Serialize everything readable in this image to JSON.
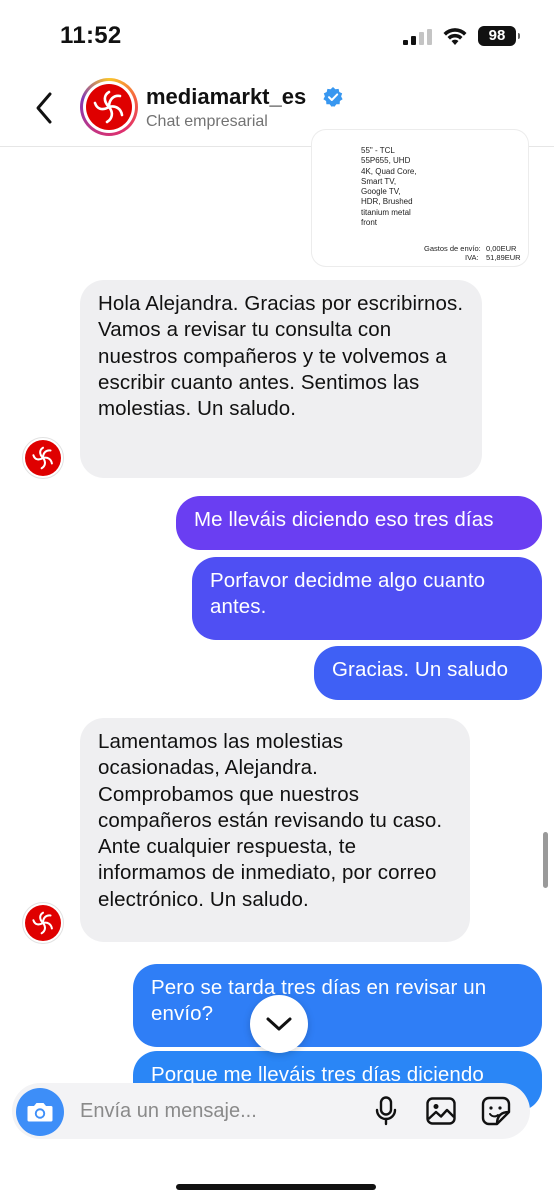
{
  "status_bar": {
    "time": "11:52",
    "battery": "98"
  },
  "header": {
    "name": "mediamarkt_es",
    "subtitle": "Chat empresarial"
  },
  "invoice": {
    "product": "55\" - TCL 55P655, UHD 4K, Quad Core, Smart TV, Google TV, HDR, Brushed titanium metal front",
    "shipping_label": "Gastos de envío:",
    "shipping_value": "0,00EUR",
    "vat_label": "IVA:",
    "vat_value": "51,89EUR"
  },
  "messages": [
    {
      "type": "received",
      "text": "Hola Alejandra. Gracias por escribirnos. Vamos a revisar tu consulta con nuestros compañeros y te volvemos a escribir cuanto antes. Sentimos las molestias. Un saludo."
    },
    {
      "type": "sent",
      "text": "Me lleváis diciendo eso tres días"
    },
    {
      "type": "sent",
      "text": "Porfavor decidme algo cuanto antes."
    },
    {
      "type": "sent",
      "text": "Gracias. Un saludo"
    },
    {
      "type": "received",
      "text": "Lamentamos las molestias ocasionadas, Alejandra. Comprobamos que nuestros compañeros están revisando tu caso. Ante cualquier respuesta, te informamos de inmediato, por correo electrónico. Un saludo."
    },
    {
      "type": "sent",
      "text": "Pero se tarda tres días en revisar un envío?"
    },
    {
      "type": "sent",
      "text": "Porque me lleváis tres días diciendo"
    }
  ],
  "composer": {
    "placeholder": "Envía un mensaje..."
  },
  "colors": {
    "sent_1": "#6a3ef2",
    "sent_2": "#4f4ff3",
    "sent_3": "#3f60f5",
    "sent_4": "#2f7ef6",
    "sent_5": "#2a86f6",
    "received": "#efeff1",
    "brand_red": "#df0000",
    "camera": "#3d8ef8"
  },
  "icons": {
    "back": "chevron-left-icon",
    "verified": "verified-badge-icon",
    "scroll_down": "chevron-down-icon",
    "camera": "camera-icon",
    "mic": "microphone-icon",
    "gallery": "image-icon",
    "sticker": "sticker-icon"
  }
}
